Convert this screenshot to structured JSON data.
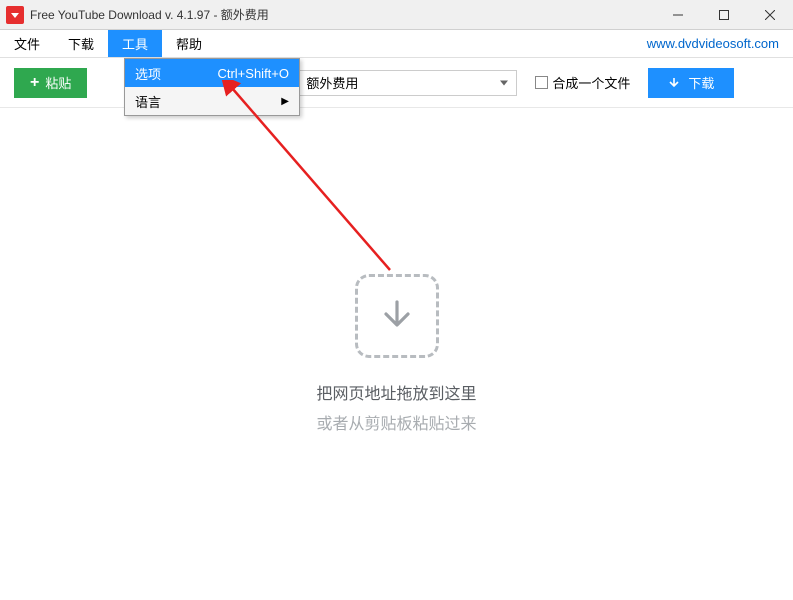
{
  "titlebar": {
    "title": "Free YouTube Download v. 4.1.97 - 额外费用"
  },
  "menubar": {
    "items": [
      {
        "label": "文件"
      },
      {
        "label": "下载"
      },
      {
        "label": "工具"
      },
      {
        "label": "帮助"
      }
    ],
    "link": "www.dvdvideosoft.com"
  },
  "dropdown": {
    "items": [
      {
        "label": "选项",
        "shortcut": "Ctrl+Shift+O"
      },
      {
        "label": "语言"
      }
    ]
  },
  "toolbar": {
    "paste_label": "粘贴",
    "format_value": "额外费用",
    "merge_label": "合成一个文件",
    "download_label": "下载"
  },
  "dropzone": {
    "line1": "把网页地址拖放到这里",
    "line2": "或者从剪贴板粘贴过来"
  }
}
